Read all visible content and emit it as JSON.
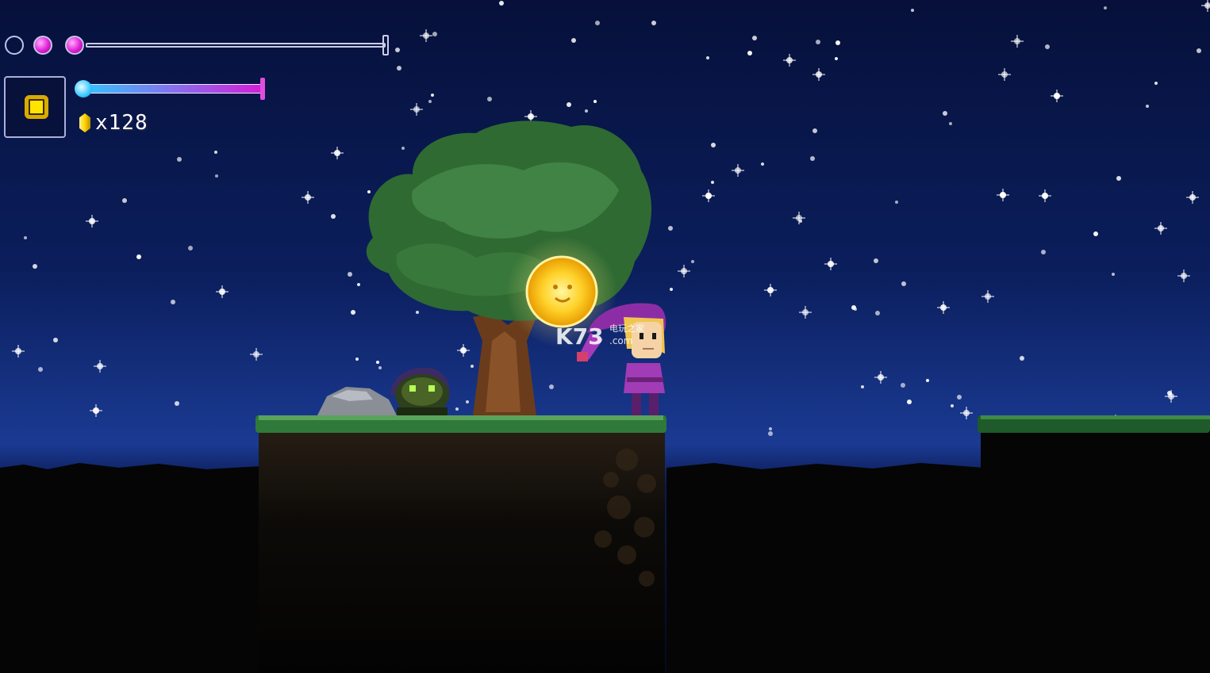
{
  "hud": {
    "health_gems": [
      {
        "state": "empty"
      },
      {
        "state": "full"
      },
      {
        "state": "full"
      }
    ],
    "mana_level": 1.0,
    "equipped_item_icon": "coin-icon",
    "currency_icon": "yellow-gem-icon",
    "currency_count": "x128"
  },
  "watermark": {
    "logo": "K73",
    "subtitle": "电玩之家",
    "domain": ".com"
  },
  "colors": {
    "sky_top": "#06103a",
    "sky_horizon": "#1a3a92",
    "health_gem": "#e21fd6",
    "mana_start": "#2fc7ff",
    "mana_end": "#d91ad8",
    "grass": "#2f7a3a",
    "tree_leaves": "#3b7a3c",
    "sun": "#ffd22a",
    "hero_outfit": "#a23bb6"
  }
}
